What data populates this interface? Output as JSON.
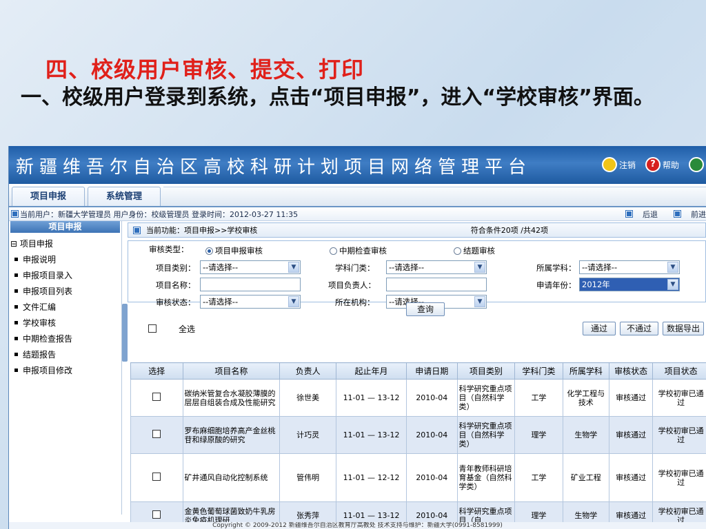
{
  "slide": {
    "title": "四、校级用户审核、提交、打印",
    "subtitle": "一、校级用户登录到系统，点击“项目申报”，进入“学校审核”界面。"
  },
  "app": {
    "banner_title": "新疆维吾尔自治区高校科研计划项目网络管理平台",
    "banner_links": {
      "logout": "注销",
      "help": "帮助"
    },
    "tabs": [
      "项目申报",
      "系统管理"
    ],
    "infobar": {
      "text": "当前用户：新疆大学管理员 用户身份：校级管理员 登录时间：2012-03-27 11:35",
      "back": "后退",
      "forward": "前进"
    },
    "sidebar": {
      "header": "项目申报",
      "group": "项目申报",
      "items": [
        "申报说明",
        "申报项目录入",
        "申报项目列表",
        "文件汇编",
        "学校审核",
        "中期检查报告",
        "结题报告",
        "申报项目修改"
      ]
    },
    "function_bar": {
      "current": "当前功能：项目申报>>学校审核",
      "count": "符合条件20项 /共42项"
    },
    "search": {
      "audit_type_label": "审核类型：",
      "audit_types": [
        "项目申报审核",
        "中期检查审核",
        "结题审核"
      ],
      "project_category_label": "项目类别：",
      "project_category_value": "--请选择--",
      "discipline_label": "学科门类：",
      "discipline_value": "--请选择--",
      "subject_label": "所属学科：",
      "subject_value": "--请选择--",
      "project_name_label": "项目名称：",
      "project_name_value": "",
      "leader_label": "项目负责人：",
      "leader_value": "",
      "year_label": "申请年份：",
      "year_value": "2012年",
      "status_label": "审核状态：",
      "status_value": "--请选择--",
      "org_label": "所在机构：",
      "org_value": "--请选择--",
      "query_button": "查询"
    },
    "actions": {
      "select_all": "全选",
      "pass": "通过",
      "fail": "不通过",
      "export": "数据导出"
    },
    "table": {
      "headers": [
        "选择",
        "项目名称",
        "负责人",
        "起止年月",
        "申请日期",
        "项目类别",
        "学科门类",
        "所属学科",
        "审核状态",
        "项目状态"
      ],
      "rows": [
        [
          "",
          "碳纳米管复合水凝胶薄膜的层层自组装合成及性能研究",
          "徐世美",
          "11-01 — 13-12",
          "2010-04",
          "科学研究重点项目（自然科学类）",
          "工学",
          "化学工程与技术",
          "审核通过",
          "学校初审已通过"
        ],
        [
          "",
          "罗布麻细胞培养高产金丝桃苷和绿原酸的研究",
          "计巧灵",
          "11-01 — 13-12",
          "2010-04",
          "科学研究重点项目（自然科学类）",
          "理学",
          "生物学",
          "审核通过",
          "学校初审已通过"
        ],
        [
          "",
          "矿井通风自动化控制系统",
          "管伟明",
          "11-01 — 12-12",
          "2010-04",
          "青年教师科研培育基金（自然科学类）",
          "工学",
          "矿业工程",
          "审核通过",
          "学校初审已通过"
        ],
        [
          "",
          "金黄色葡萄球菌致奶牛乳房炎免疫机理研",
          "张秀萍",
          "11-01 — 13-12",
          "2010-04",
          "科学研究重点项目（自",
          "理学",
          "生物学",
          "审核通过",
          "学校初审已通过"
        ]
      ]
    },
    "footer": "Copyright © 2009-2012 新疆维吾尔自治区教育厅高教处    技术支持与维护：新疆大学(0991-8581999)"
  }
}
